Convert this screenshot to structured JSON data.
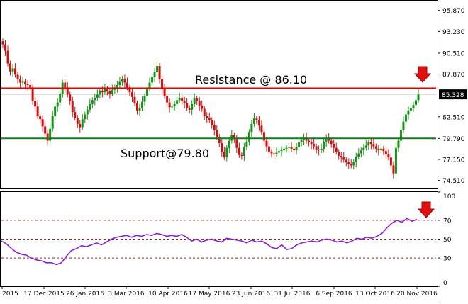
{
  "chart_data": [
    {
      "panel": "price",
      "type": "candlestick",
      "ylim": [
        73.5,
        97.0
      ],
      "y_ticks": [
        "95.870",
        "93.230",
        "90.510",
        "87.870",
        "85.328",
        "82.510",
        "79.790",
        "77.150",
        "74.510"
      ],
      "current_price": "85.328",
      "current_price_value": 85.328,
      "grid": false,
      "lines": [
        {
          "name": "resistance",
          "value": 86.1,
          "color": "#e00000",
          "label": "Resistance @ 86.10"
        },
        {
          "name": "support",
          "value": 79.8,
          "color": "#1a7a1a",
          "label": "Support@79.80"
        }
      ],
      "up_color": "#1a8f1a",
      "down_color": "#d01010",
      "closes": [
        91.6,
        90.8,
        89.2,
        88.2,
        88.6,
        87.8,
        87.2,
        86.8,
        86.9,
        86.6,
        86.5,
        86.2,
        84.5,
        83.8,
        82.6,
        82.2,
        81.3,
        80.4,
        79.5,
        81.0,
        82.6,
        83.8,
        84.3,
        85.4,
        86.8,
        86.2,
        85.3,
        84.5,
        83.1,
        82.4,
        81.6,
        81.2,
        82.2,
        82.8,
        83.4,
        84.1,
        84.6,
        84.9,
        85.3,
        85.8,
        85.6,
        86.0,
        85.7,
        85.4,
        85.9,
        86.2,
        86.5,
        86.9,
        87.3,
        86.8,
        86.2,
        85.6,
        85.0,
        84.2,
        83.3,
        83.6,
        84.4,
        85.1,
        86.0,
        86.8,
        87.5,
        88.1,
        88.9,
        87.2,
        86.0,
        85.1,
        84.3,
        83.7,
        83.8,
        84.1,
        84.6,
        84.9,
        84.5,
        84.2,
        83.6,
        83.4,
        84.1,
        84.8,
        84.5,
        83.9,
        83.5,
        82.6,
        82.4,
        82.1,
        81.5,
        80.8,
        80.0,
        79.2,
        78.1,
        77.4,
        78.6,
        79.5,
        80.2,
        79.7,
        78.6,
        77.7,
        77.6,
        78.7,
        79.4,
        80.6,
        81.6,
        82.3,
        82.1,
        81.4,
        80.6,
        79.5,
        78.8,
        78.1,
        77.9,
        77.8,
        78.0,
        78.2,
        78.3,
        78.5,
        78.6,
        78.7,
        78.5,
        78.4,
        78.7,
        79.3,
        79.6,
        79.9,
        79.5,
        79.3,
        79.1,
        78.8,
        78.4,
        78.3,
        78.5,
        79.4,
        79.8,
        79.5,
        79.1,
        78.6,
        78.1,
        77.6,
        77.4,
        77.1,
        76.8,
        76.6,
        76.4,
        76.8,
        77.5,
        77.9,
        78.3,
        78.6,
        78.9,
        79.3,
        79.1,
        78.8,
        78.5,
        78.3,
        78.5,
        78.2,
        77.8,
        77.4,
        76.4,
        75.4,
        78.6,
        79.5,
        80.8,
        81.9,
        82.8,
        83.3,
        83.6,
        84.0,
        84.6,
        85.3
      ]
    },
    {
      "panel": "rsi",
      "type": "line",
      "ylim": [
        0,
        100
      ],
      "y_ticks": [
        "100",
        "70",
        "50",
        "30",
        "0"
      ],
      "levels": [
        70,
        50,
        30
      ],
      "line_color": "#8a20c8",
      "level_color": "#b02020",
      "x_labels": [
        "2015",
        "17 Dec 2015",
        "26 Jan 2016",
        "3 Mar 2016",
        "10 Apr 2016",
        "17 May 2016",
        "23 Jun 2016",
        "31 Jul 2016",
        "6 Sep 2016",
        "13 Oct 2016",
        "20 Nov 2016"
      ],
      "x_label_positions": [
        0.3,
        6.2,
        12.0,
        17.8,
        23.7,
        29.5,
        35.4,
        41.2,
        47.1,
        52.9,
        58.8
      ],
      "values": [
        48,
        45,
        40,
        36,
        34,
        33,
        30,
        28,
        27,
        25,
        25,
        23,
        25,
        32,
        38,
        40,
        43,
        42,
        44,
        46,
        44,
        47,
        50,
        52,
        53,
        54,
        52,
        54,
        53,
        55,
        54,
        56,
        55,
        53,
        54,
        53,
        55,
        52,
        48,
        50,
        47,
        49,
        50,
        48,
        47,
        51,
        50,
        49,
        48,
        46,
        49,
        47,
        48,
        45,
        41,
        40,
        44,
        39,
        40,
        44,
        46,
        47,
        48,
        47,
        49,
        50,
        49,
        47,
        48,
        46,
        48,
        51,
        50,
        52,
        51,
        53,
        56,
        62,
        67,
        70,
        68,
        72,
        69,
        71
      ]
    }
  ],
  "annotations": {
    "resistance_text": "Resistance @ 86.10",
    "support_text": "Support@79.80"
  }
}
